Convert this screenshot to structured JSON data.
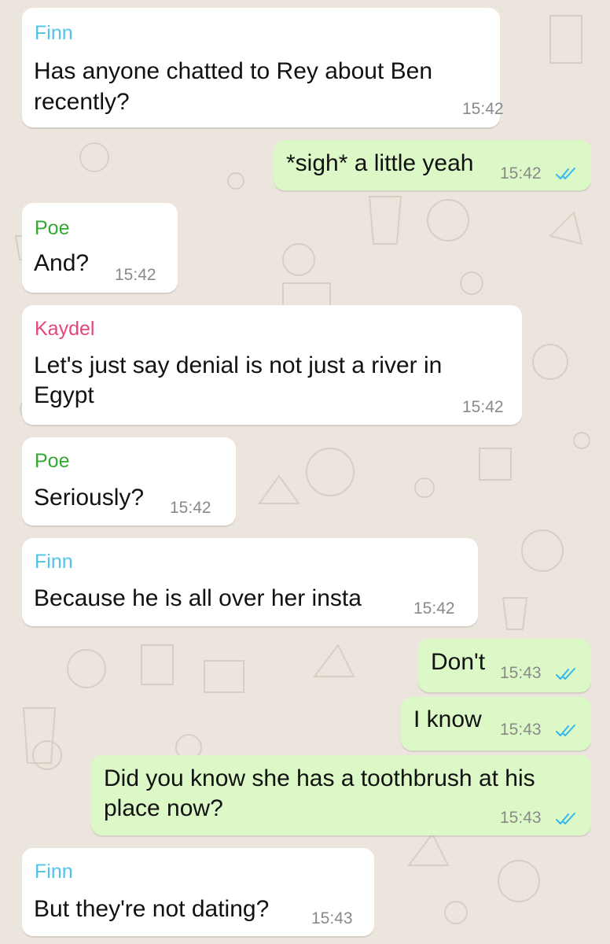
{
  "colors": {
    "wallpaper": "#ece5dd",
    "incoming_bubble": "#ffffff",
    "outgoing_bubble": "#dcf8c6",
    "read_ticks": "#34b7f1",
    "timestamp": "#8a8a8a"
  },
  "messages": [
    {
      "direction": "incoming",
      "sender": "Finn",
      "sender_color": "#4fc3e8",
      "lines": [
        "Has anyone chatted to Rey about Ben",
        "recently?"
      ],
      "time": "15:42"
    },
    {
      "direction": "outgoing",
      "lines": [
        "*sigh* a little yeah"
      ],
      "time": "15:42",
      "status_icon": "double-check-read-icon"
    },
    {
      "direction": "incoming",
      "sender": "Poe",
      "sender_color": "#35a834",
      "lines": [
        "And?"
      ],
      "time": "15:42"
    },
    {
      "direction": "incoming",
      "sender": "Kaydel",
      "sender_color": "#e5457a",
      "lines": [
        "Let's just say denial is not just a river in",
        "Egypt"
      ],
      "time": "15:42"
    },
    {
      "direction": "incoming",
      "sender": "Poe",
      "sender_color": "#35a834",
      "lines": [
        "Seriously?"
      ],
      "time": "15:42"
    },
    {
      "direction": "incoming",
      "sender": "Finn",
      "sender_color": "#4fc3e8",
      "lines": [
        "Because he is all over her insta"
      ],
      "time": "15:42"
    },
    {
      "direction": "outgoing",
      "lines": [
        "Don't"
      ],
      "time": "15:43",
      "status_icon": "double-check-read-icon"
    },
    {
      "direction": "outgoing",
      "lines": [
        "I know"
      ],
      "time": "15:43",
      "status_icon": "double-check-read-icon"
    },
    {
      "direction": "outgoing",
      "lines": [
        "Did you know she has a toothbrush at his",
        "place now?"
      ],
      "time": "15:43",
      "status_icon": "double-check-read-icon"
    },
    {
      "direction": "incoming",
      "sender": "Finn",
      "sender_color": "#4fc3e8",
      "lines": [
        "But they're not dating?"
      ],
      "time": "15:43"
    }
  ]
}
